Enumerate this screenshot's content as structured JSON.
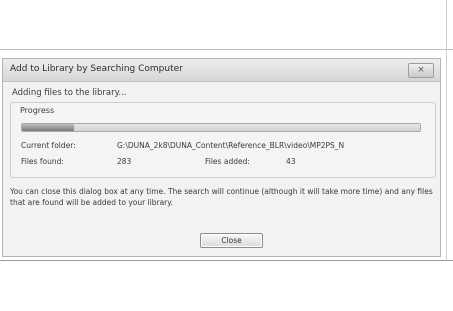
{
  "dialog": {
    "title": "Add to Library by Searching Computer",
    "close_icon": "×",
    "status_text": "Adding files to the library...",
    "progress": {
      "label": "Progress",
      "fraction": 0.13
    },
    "current_folder": {
      "label": "Current folder:",
      "value": "G:\\DUNA_2k8\\DUNA_Content\\Reference_BLR\\video\\MP2PS_N"
    },
    "files_found": {
      "label": "Files found:",
      "value": "283"
    },
    "files_added": {
      "label": "Files added:",
      "value": "43"
    },
    "message": "You can close this dialog box at any time. The search will continue (although it will take more time) and any files that are found will be added to your library.",
    "close_button": "Close"
  }
}
